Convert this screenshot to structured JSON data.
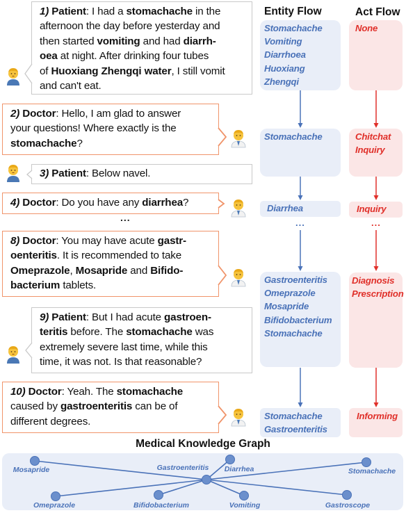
{
  "dialogue": [
    {
      "id": "turn-1",
      "role": "patient",
      "num": "1)",
      "speaker": "Patient",
      "segments": [
        {
          "t": ": I had a "
        },
        {
          "t": "stomachache",
          "b": true
        },
        {
          "t": " in the afternoon the day before yesterday and then started "
        },
        {
          "t": "vomiting",
          "b": true
        },
        {
          "t": " and had "
        },
        {
          "t": "diarrh-oea",
          "b": true,
          "lines": [
            "diarrh-",
            "oea"
          ]
        },
        {
          "t": " at night. After drinking four tubes of "
        },
        {
          "t": "Huoxiang Zhengqi water",
          "b": true
        },
        {
          "t": ", I still vomit and can't eat."
        }
      ],
      "lines": [
        [
          {
            "t": "1)",
            "n": true
          },
          {
            "t": " "
          },
          {
            "t": "Patient",
            "b": true
          },
          {
            "t": ": I had a "
          },
          {
            "t": "stomachache",
            "b": true
          },
          {
            "t": " in the"
          }
        ],
        [
          {
            "t": "afternoon the day before yesterday and"
          }
        ],
        [
          {
            "t": "then started "
          },
          {
            "t": "vomiting",
            "b": true
          },
          {
            "t": " and had "
          },
          {
            "t": "diarrh-",
            "b": true
          }
        ],
        [
          {
            "t": "oea",
            "b": true
          },
          {
            "t": " at night. After drinking four tubes"
          }
        ],
        [
          {
            "t": "of "
          },
          {
            "t": "Huoxiang Zhengqi water",
            "b": true
          },
          {
            "t": ", I still vomit"
          }
        ],
        [
          {
            "t": "and can't eat."
          }
        ]
      ]
    },
    {
      "id": "turn-2",
      "role": "doctor",
      "lines": [
        [
          {
            "t": "2)",
            "n": true
          },
          {
            "t": " "
          },
          {
            "t": "Doctor",
            "b": true
          },
          {
            "t": ": Hello, I am glad to answer"
          }
        ],
        [
          {
            "t": "your questions! Where exactly is the"
          }
        ],
        [
          {
            "t": "stomachache",
            "b": true
          },
          {
            "t": "?"
          }
        ]
      ]
    },
    {
      "id": "turn-3",
      "role": "patient",
      "lines": [
        [
          {
            "t": "3)",
            "n": true
          },
          {
            "t": " "
          },
          {
            "t": "Patient",
            "b": true
          },
          {
            "t": ": Below navel."
          }
        ]
      ]
    },
    {
      "id": "turn-4",
      "role": "doctor",
      "lines": [
        [
          {
            "t": "4)",
            "n": true
          },
          {
            "t": " "
          },
          {
            "t": "Doctor",
            "b": true
          },
          {
            "t": ": Do you have any "
          },
          {
            "t": "diarrhea",
            "b": true
          },
          {
            "t": "?"
          }
        ]
      ]
    },
    {
      "id": "turn-8",
      "role": "doctor",
      "lines": [
        [
          {
            "t": "8)",
            "n": true
          },
          {
            "t": " "
          },
          {
            "t": "Doctor",
            "b": true
          },
          {
            "t": ": You may have acute "
          },
          {
            "t": "gastr-",
            "b": true
          }
        ],
        [
          {
            "t": "oenteritis",
            "b": true
          },
          {
            "t": ". It is recommended to take"
          }
        ],
        [
          {
            "t": "Omeprazole",
            "b": true
          },
          {
            "t": ", "
          },
          {
            "t": "Mosapride",
            "b": true
          },
          {
            "t": " and "
          },
          {
            "t": "Bifido-",
            "b": true
          }
        ],
        [
          {
            "t": "bacterium",
            "b": true
          },
          {
            "t": " tablets."
          }
        ]
      ]
    },
    {
      "id": "turn-9",
      "role": "patient",
      "lines": [
        [
          {
            "t": "9)",
            "n": true
          },
          {
            "t": " "
          },
          {
            "t": "Patient",
            "b": true
          },
          {
            "t": ": But I had acute "
          },
          {
            "t": "gastroen-",
            "b": true
          }
        ],
        [
          {
            "t": "teritis",
            "b": true
          },
          {
            "t": " before. The "
          },
          {
            "t": "stomachache",
            "b": true
          },
          {
            "t": " was"
          }
        ],
        [
          {
            "t": "extremely severe last time, while this"
          }
        ],
        [
          {
            "t": "time, it was not. Is that reasonable?"
          }
        ]
      ]
    },
    {
      "id": "turn-10",
      "role": "doctor",
      "lines": [
        [
          {
            "t": "10)",
            "n": true
          },
          {
            "t": " "
          },
          {
            "t": "Doctor",
            "b": true
          },
          {
            "t": ": Yeah. The "
          },
          {
            "t": "stomachache",
            "b": true
          }
        ],
        [
          {
            "t": "caused by "
          },
          {
            "t": "gastroenteritis",
            "b": true
          },
          {
            "t": " can be of"
          }
        ],
        [
          {
            "t": "different degrees."
          }
        ]
      ]
    }
  ],
  "dialogue_ellipsis": "...",
  "entity_flow": {
    "title": "Entity Flow",
    "steps": [
      [
        "Stomachache",
        "Vomiting",
        "Diarrhoea",
        "Huoxiang Zhengqi"
      ],
      [
        "Stomachache"
      ],
      [
        "Diarrhea"
      ],
      [
        "Gastroenteritis",
        "Omeprazole",
        "Mosapride",
        "Bifidobacterium",
        "Stomachache"
      ],
      [
        "Stomachache",
        "Gastroenteritis"
      ]
    ],
    "ellipsis": "...",
    "color": "#4a72b8"
  },
  "act_flow": {
    "title": "Act Flow",
    "steps": [
      [
        "None"
      ],
      [
        "Chitchat",
        "Inquiry"
      ],
      [
        "Inquiry"
      ],
      [
        "Diagnosis",
        "Prescription"
      ],
      [
        "Informing"
      ]
    ],
    "ellipsis": "...",
    "color": "#e0302a"
  },
  "knowledge_graph": {
    "title": "Medical Knowledge Graph",
    "center": "Gastroenteritis",
    "nodes": [
      "Mosapride",
      "Omeprazole",
      "Bifidobacterium",
      "Gastroenteritis",
      "Diarrhea",
      "Vomiting",
      "Stomachache",
      "Gastroscope"
    ],
    "edges": [
      [
        "Gastroenteritis",
        "Mosapride"
      ],
      [
        "Gastroenteritis",
        "Omeprazole"
      ],
      [
        "Gastroenteritis",
        "Bifidobacterium"
      ],
      [
        "Gastroenteritis",
        "Diarrhea"
      ],
      [
        "Gastroenteritis",
        "Vomiting"
      ],
      [
        "Gastroenteritis",
        "Stomachache"
      ],
      [
        "Gastroenteritis",
        "Gastroscope"
      ]
    ]
  },
  "colors": {
    "doctor_border": "#f0946a",
    "patient_border": "#c9c9c9",
    "entity": "#4a72b8",
    "act": "#e0302a",
    "entity_bg": "#e9eef8",
    "act_bg": "#fbe6e6"
  }
}
